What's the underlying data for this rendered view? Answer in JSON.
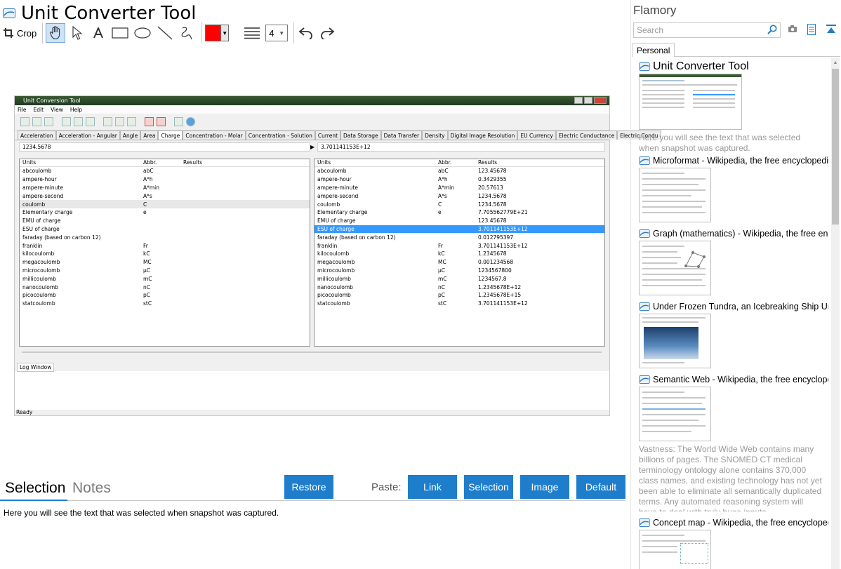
{
  "main": {
    "title": "Unit Converter Tool",
    "toolbar": {
      "crop_label": "Crop",
      "line_width_value": "4",
      "color": "#ff0000"
    }
  },
  "screenshot": {
    "window_title": "Unit Conversion Tool",
    "menu": [
      "File",
      "Edit",
      "View",
      "Help"
    ],
    "tabs": [
      "Acceleration",
      "Acceleration - Angular",
      "Angle",
      "Area",
      "Charge",
      "Concentration - Molar",
      "Concentration - Solution",
      "Current",
      "Data Storage",
      "Data Transfer",
      "Density",
      "Digital Image Resolution",
      "EU Currency",
      "Electric Conductance",
      "Electric Condu"
    ],
    "active_tab": "Charge",
    "input_value": "1234.5678",
    "output_value": "3.701141153E+12",
    "columns": [
      "Units",
      "Abbr.",
      "Results"
    ],
    "left_rows": [
      {
        "unit": "abcoulomb",
        "abbr": "abC"
      },
      {
        "unit": "ampere-hour",
        "abbr": "A*h"
      },
      {
        "unit": "ampere-minute",
        "abbr": "A*min"
      },
      {
        "unit": "ampere-second",
        "abbr": "A*s"
      },
      {
        "unit": "coulomb",
        "abbr": "C"
      },
      {
        "unit": "Elementary charge",
        "abbr": "e"
      },
      {
        "unit": "EMU of charge",
        "abbr": ""
      },
      {
        "unit": "ESU of charge",
        "abbr": ""
      },
      {
        "unit": "faraday (based on carbon 12)",
        "abbr": ""
      },
      {
        "unit": "franklin",
        "abbr": "Fr"
      },
      {
        "unit": "kilocoulomb",
        "abbr": "kC"
      },
      {
        "unit": "megacoulomb",
        "abbr": "MC"
      },
      {
        "unit": "microcoulomb",
        "abbr": "µC"
      },
      {
        "unit": "millicoulomb",
        "abbr": "mC"
      },
      {
        "unit": "nanocoulomb",
        "abbr": "nC"
      },
      {
        "unit": "picocoulomb",
        "abbr": "pC"
      },
      {
        "unit": "statcoulomb",
        "abbr": "stC"
      }
    ],
    "right_rows": [
      {
        "unit": "abcoulomb",
        "abbr": "abC",
        "result": "123.45678"
      },
      {
        "unit": "ampere-hour",
        "abbr": "A*h",
        "result": "0.3429355"
      },
      {
        "unit": "ampere-minute",
        "abbr": "A*min",
        "result": "20.57613"
      },
      {
        "unit": "ampere-second",
        "abbr": "A*s",
        "result": "1234.5678"
      },
      {
        "unit": "coulomb",
        "abbr": "C",
        "result": "1234.5678"
      },
      {
        "unit": "Elementary charge",
        "abbr": "e",
        "result": "7.705562779E+21"
      },
      {
        "unit": "EMU of charge",
        "abbr": "",
        "result": "123.45678"
      },
      {
        "unit": "ESU of charge",
        "abbr": "",
        "result": "3.701141153E+12"
      },
      {
        "unit": "faraday (based on carbon 12)",
        "abbr": "",
        "result": "0.012795397"
      },
      {
        "unit": "franklin",
        "abbr": "Fr",
        "result": "3.701141153E+12"
      },
      {
        "unit": "kilocoulomb",
        "abbr": "kC",
        "result": "1.2345678"
      },
      {
        "unit": "megacoulomb",
        "abbr": "MC",
        "result": "0.001234568"
      },
      {
        "unit": "microcoulomb",
        "abbr": "µC",
        "result": "1234567800"
      },
      {
        "unit": "millicoulomb",
        "abbr": "mC",
        "result": "1234567.8"
      },
      {
        "unit": "nanocoulomb",
        "abbr": "nC",
        "result": "1.2345678E+12"
      },
      {
        "unit": "picocoulomb",
        "abbr": "pC",
        "result": "1.2345678E+15"
      },
      {
        "unit": "statcoulomb",
        "abbr": "stC",
        "result": "3.701141153E+12"
      }
    ],
    "log_tab": "Log Window",
    "status": "Ready"
  },
  "bottom": {
    "tab_selection": "Selection",
    "tab_notes": "Notes",
    "restore_label": "Restore",
    "paste_label": "Paste:",
    "link_label": "Link",
    "selection_label": "Selection",
    "image_label": "Image",
    "default_label": "Default",
    "selection_text": "Here you will see the text that was selected when snapshot was captured."
  },
  "sidebar": {
    "app_name": "Flamory",
    "search_placeholder": "Search",
    "tab_personal": "Personal",
    "entries": [
      {
        "title": "Unit Converter Tool",
        "desc": "Here you will see the text that was selected when snapshot was captured."
      },
      {
        "title": "Microformat - Wikipedia, the free encyclopedia"
      },
      {
        "title": "Graph (mathematics) - Wikipedia, the free encyclopedia"
      },
      {
        "title": "Under Frozen Tundra, an Icebreaking Ship Uncovers"
      },
      {
        "title": "Semantic Web - Wikipedia, the free encyclopedia",
        "desc": "Vastness: The World Wide Web contains many billions of pages. The SNOMED CT medical terminology ontology alone contains 370,000 class names, and existing technology has not yet been able to eliminate all semantically duplicated terms. Any automated reasoning system will have to deal with truly huge inputs."
      },
      {
        "title": "Concept map - Wikipedia, the free encyclopedia"
      }
    ]
  }
}
